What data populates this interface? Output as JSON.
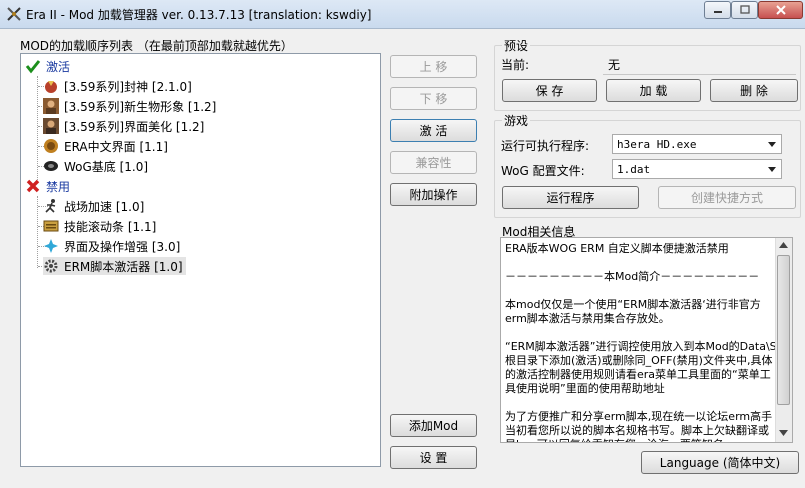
{
  "window": {
    "title": "Era II - Mod 加载管理器 ver. 0.13.7.13 [translation: kswdiy]"
  },
  "mod_list": {
    "label": "MOD的加载顺序列表 （在最前顶部加载就越优先）",
    "groups": [
      {
        "name": "激活",
        "icon": "check-icon",
        "color": "#1c8f1c",
        "items": [
          {
            "label": "[3.59系列]封神 [2.1.0]",
            "icon": "fengshen-icon"
          },
          {
            "label": "[3.59系列]新生物形象 [1.2]",
            "icon": "portrait-icon"
          },
          {
            "label": "[3.59系列]界面美化 [1.2]",
            "icon": "portrait-icon"
          },
          {
            "label": "ERA中文界面 [1.1]",
            "icon": "era-icon"
          },
          {
            "label": "WoG基底 [1.0]",
            "icon": "wog-icon"
          }
        ]
      },
      {
        "name": "禁用",
        "icon": "cross-icon",
        "color": "#d02020",
        "items": [
          {
            "label": "战场加速 [1.0]",
            "icon": "runner-icon"
          },
          {
            "label": "技能滚动条 [1.1]",
            "icon": "scroll-bar-icon"
          },
          {
            "label": "界面及操作增强 [3.0]",
            "icon": "sparkle-icon"
          },
          {
            "label": "ERM脚本激活器 [1.0]",
            "icon": "gear-icon"
          }
        ]
      }
    ]
  },
  "actions": {
    "move_up": "上 移",
    "move_down": "下 移",
    "activate": "激 活",
    "compat": "兼容性",
    "extra": "附加操作",
    "add_mod": "添加Mod",
    "settings": "设 置"
  },
  "preset": {
    "label": "预设",
    "current_label": "当前:",
    "current_value": "无",
    "save": "保 存",
    "load": "加 载",
    "delete": "删 除"
  },
  "game": {
    "label": "游戏",
    "exe_label": "运行可执行程序:",
    "exe_value": "h3era HD.exe",
    "wog_label": "WoG 配置文件:",
    "wog_value": "1.dat",
    "run": "运行程序",
    "shortcut": "创建快捷方式"
  },
  "mod_info": {
    "label": "Mod相关信息",
    "paragraphs": [
      "ERA版本WOG ERM 自定义脚本便捷激活禁用",
      "－－－－－－－－－本Mod简介－－－－－－－－－",
      "本mod仅仅是一个使用“ERM脚本激活器‘进行非官方erm脚本激活与禁用集合存放处。",
      "“ERM脚本激活器”进行调控使用放入到本Mod的Data\\S根目录下添加(激活)或删除同_OFF(禁用)文件夹中,具体的激活控制器使用规则请看era菜单工具里面的“菜单工具使用说明”里面的使用帮助地址",
      "为了方便推广和分享erm脚本,现在统一以论坛erm高手当初看您所以说的脚本名规格书写。脚本上欠缺翻译或是bug可以回复给贡知有您、沧海一粟等知名"
    ]
  },
  "language_button": "Language (简体中文)",
  "colors": {
    "accent": "#0000ff",
    "active": "#1c8f1c",
    "disabled": "#d02020"
  }
}
